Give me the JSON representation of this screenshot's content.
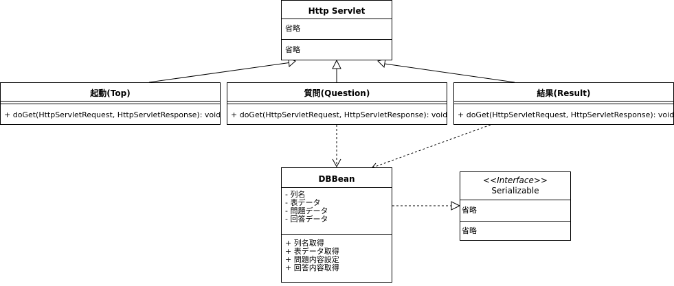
{
  "servlet": {
    "name": "Http Servlet",
    "attributes": "省略",
    "operations": "省略"
  },
  "top": {
    "name": "起動(Top)",
    "operation": "+ doGet(HttpServletRequest, HttpServletResponse): void"
  },
  "question": {
    "name": "質問(Question)",
    "operation": "+ doGet(HttpServletRequest, HttpServletResponse): void"
  },
  "result": {
    "name": "結果(Result)",
    "operation": "+ doGet(HttpServletRequest, HttpServletResponse): void"
  },
  "dbbean": {
    "name": "DBBean",
    "attributes": [
      "- 列名",
      "- 表データ",
      "- 問題データ",
      "- 回答データ"
    ],
    "operations": [
      "+ 列名取得",
      "+ 表データ取得",
      "+ 問題内容設定",
      "+ 回答内容取得"
    ]
  },
  "serializable": {
    "stereotype": "<<Interface>>",
    "name": "Serializable",
    "attributes": "省略",
    "operations": "省略"
  },
  "colors": {
    "line": "#000000",
    "background": "#ffffff"
  }
}
